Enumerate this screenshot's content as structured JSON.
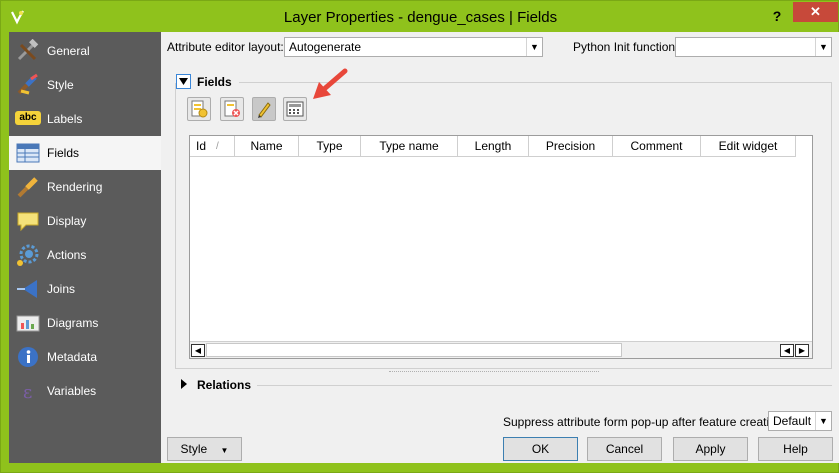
{
  "window": {
    "title": "Layer Properties - dengue_cases | Fields",
    "help_label": "?",
    "close_label": "✕"
  },
  "sidebar": {
    "items": [
      {
        "label": "General",
        "icon": "tools-icon"
      },
      {
        "label": "Style",
        "icon": "paintbrush-icon"
      },
      {
        "label": "Labels",
        "icon": "abc-icon"
      },
      {
        "label": "Fields",
        "icon": "table-icon",
        "active": true
      },
      {
        "label": "Rendering",
        "icon": "brush-icon"
      },
      {
        "label": "Display",
        "icon": "speech-bubble-icon"
      },
      {
        "label": "Actions",
        "icon": "gear-icon"
      },
      {
        "label": "Joins",
        "icon": "join-icon"
      },
      {
        "label": "Diagrams",
        "icon": "diagram-icon"
      },
      {
        "label": "Metadata",
        "icon": "info-icon"
      },
      {
        "label": "Variables",
        "icon": "epsilon-icon"
      }
    ],
    "abc_text": "abc"
  },
  "top": {
    "editor_layout_label": "Attribute editor layout:",
    "editor_layout_value": "Autogenerate",
    "python_init_label": "Python Init function",
    "python_init_value": ""
  },
  "fields_group": {
    "title": "Fields",
    "table": {
      "columns": [
        "Id",
        "Name",
        "Type",
        "Type name",
        "Length",
        "Precision",
        "Comment",
        "Edit widget"
      ]
    }
  },
  "relations_group": {
    "title": "Relations"
  },
  "bottom": {
    "suppress_label": "Suppress attribute form pop-up after feature creation",
    "suppress_value": "Default",
    "style_label": "Style",
    "ok_label": "OK",
    "cancel_label": "Cancel",
    "apply_label": "Apply",
    "help_label": "Help"
  },
  "colors": {
    "frame": "#8fc21c",
    "sidebar": "#5b5b5b",
    "close": "#c7493a",
    "annotation_arrow": "#e8473a"
  }
}
